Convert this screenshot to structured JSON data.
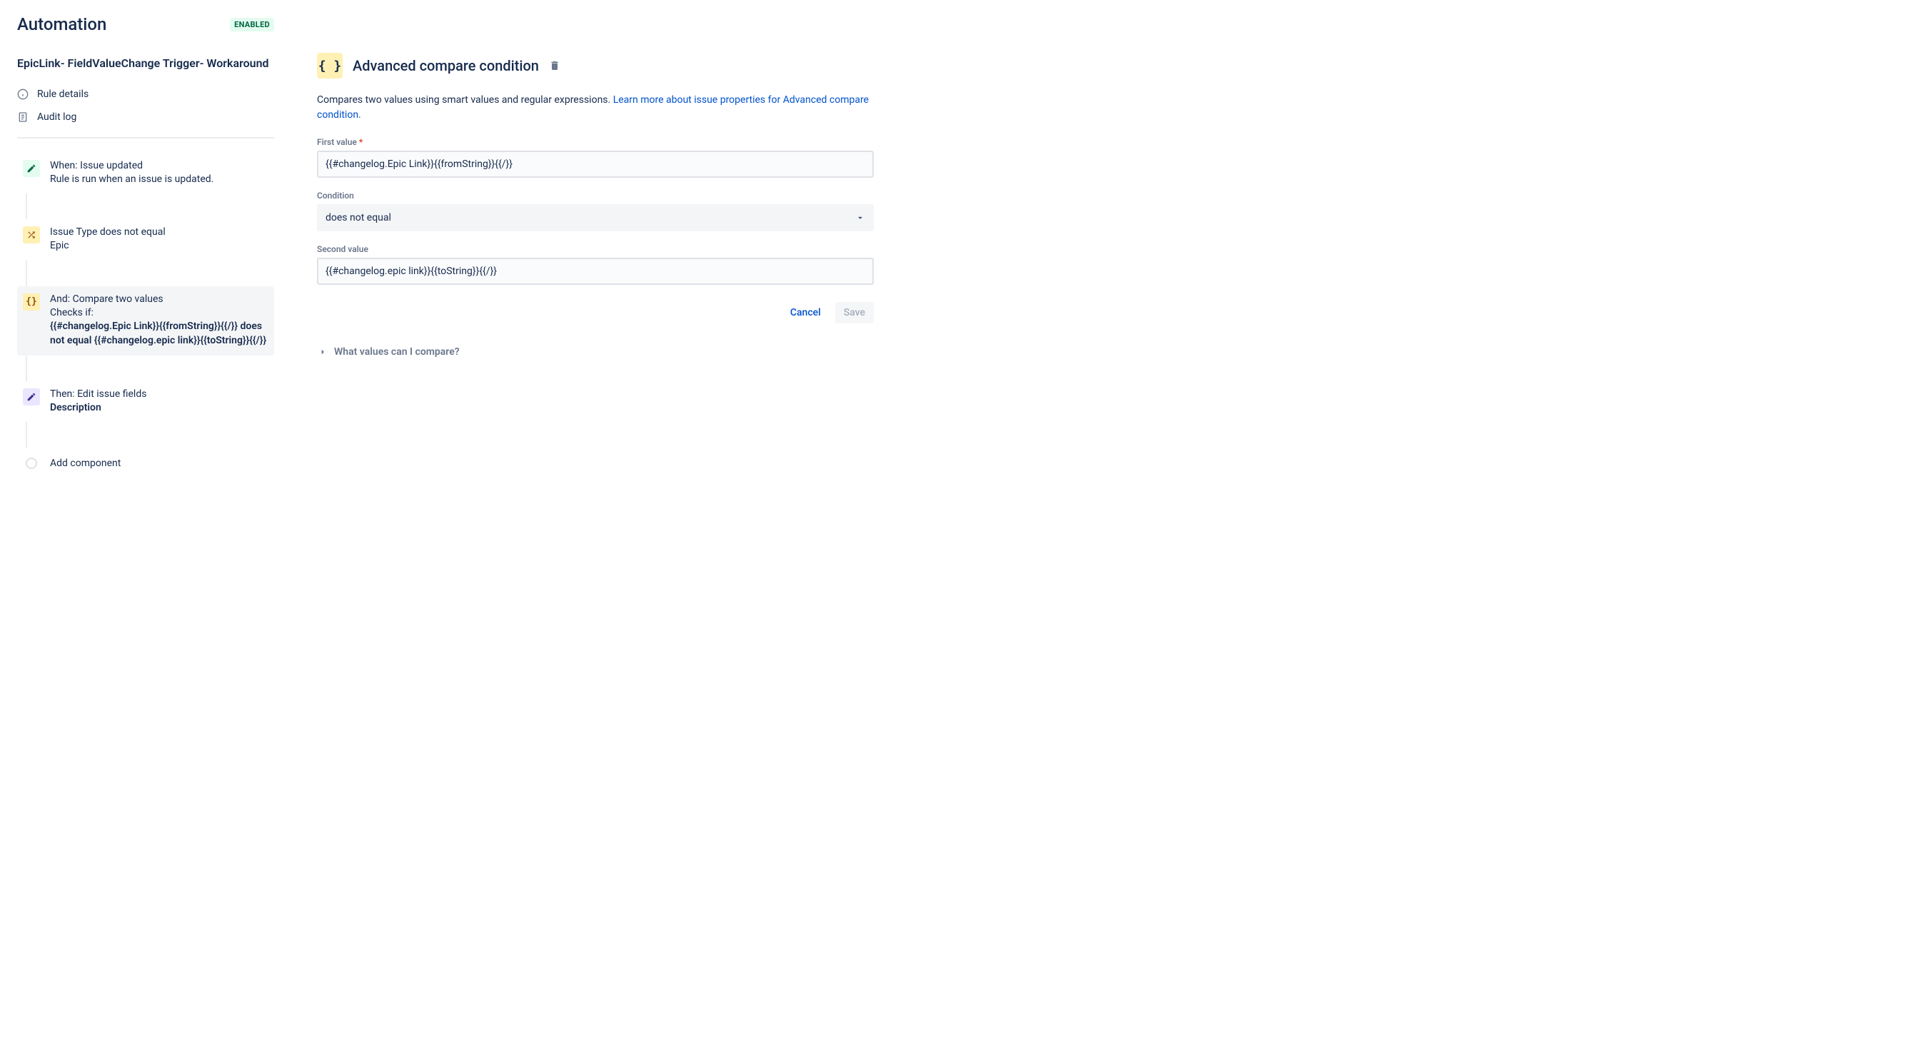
{
  "header": {
    "title": "Automation",
    "status": "ENABLED"
  },
  "rule": {
    "name": "EpicLink- FieldValueChange Trigger- Workaround",
    "meta": {
      "details": "Rule details",
      "audit": "Audit log"
    }
  },
  "steps": {
    "trigger": {
      "title": "When: Issue updated",
      "desc": "Rule is run when an issue is updated."
    },
    "cond1": {
      "title": "Issue Type does not equal",
      "desc": "Epic"
    },
    "cond2": {
      "title": "And: Compare two values",
      "desc_intro": "Checks if:",
      "desc_bold": "{{#changelog.Epic Link}}{{fromString}}{{/}} does not equal {{#changelog.epic link}}{{toString}}{{/}}"
    },
    "action": {
      "title": "Then: Edit issue fields",
      "desc_bold": "Description"
    },
    "add": "Add component"
  },
  "detail": {
    "title": "Advanced compare condition",
    "desc": "Compares two values using smart values and regular expressions. ",
    "link": "Learn more about issue properties for Advanced compare condition.",
    "labels": {
      "first": "First value",
      "condition": "Condition",
      "second": "Second value"
    },
    "values": {
      "first": "{{#changelog.Epic Link}}{{fromString}}{{/}}",
      "condition": "does not equal",
      "second": "{{#changelog.epic link}}{{toString}}{{/}}"
    },
    "buttons": {
      "cancel": "Cancel",
      "save": "Save"
    },
    "expandable": "What values can I compare?"
  }
}
